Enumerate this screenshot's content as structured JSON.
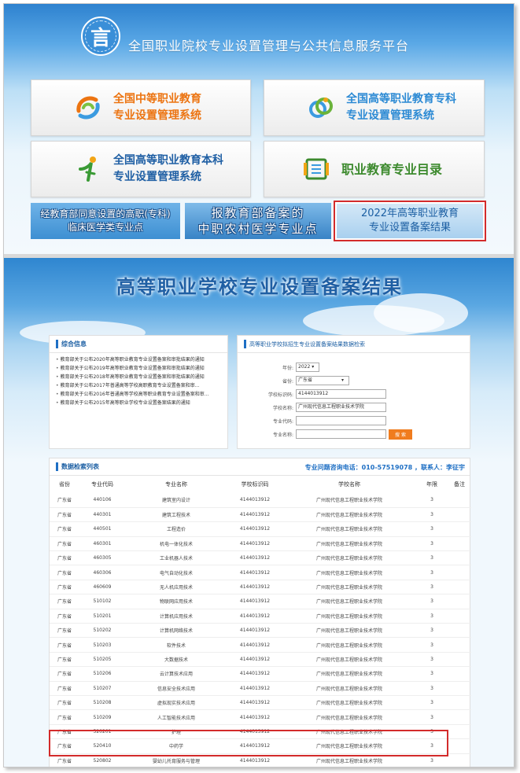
{
  "portal": {
    "title": "全国职业院校专业设置管理与公共信息服务平台",
    "systems": [
      {
        "line1": "全国中等职业教育",
        "line2": "专业设置管理系统"
      },
      {
        "line1": "全国高等职业教育专科",
        "line2": "专业设置管理系统"
      },
      {
        "line1": "全国高等职业教育本科",
        "line2": "专业设置管理系统"
      },
      {
        "line1": "职业教育专业目录"
      }
    ],
    "banners": [
      {
        "line1": "经教育部同意设置的高职(专科)",
        "line2": "临床医学类专业点"
      },
      {
        "line1": "报教育部备案的",
        "line2": "中职农村医学专业点"
      },
      {
        "line1": "2022年高等职业教育",
        "line2": "专业设置备案结果"
      }
    ]
  },
  "page_title": "高等职业学校专业设置备案结果",
  "info": {
    "heading": "综合信息",
    "news": [
      "教育部关于公布2020年高等职业教育专业设置备案和审批结果的通知",
      "教育部关于公布2019年高等职业教育专业设置备案和审批结果的通知",
      "教育部关于公布2018年高等职业教育专业设置备案和审批结果的通知",
      "教育部关于公布2017年普通高等学校高职教育专业设置备案和审...",
      "教育部关于公布2016年普通高等学校高等职业教育专业设置备案和审...",
      "教育部关于公布2015年高等职业学校专业设置备案结果的通知"
    ]
  },
  "search": {
    "heading": "高等职业学校拟招生专业设置备案结果数据检索",
    "year_label": "年份:",
    "year_value": "2022",
    "province_label": "省份:",
    "province_value": "广东省",
    "school_id_label": "学校标识码:",
    "school_id_value": "4144013912",
    "school_name_label": "学校名称:",
    "school_name_value": "广州现代信息工程职业技术学院",
    "major_code_label": "专业代码:",
    "major_code_value": "",
    "major_name_label": "专业名称:",
    "major_name_value": "",
    "button": "搜 索"
  },
  "results": {
    "heading": "数据检索列表",
    "contact": "专业问题咨询电话：010-57519078 ，联系人：李征宇",
    "columns": [
      "省份",
      "专业代码",
      "专业名称",
      "学校标识码",
      "学校名称",
      "年限",
      "备注"
    ],
    "rows": [
      [
        "广东省",
        "440106",
        "建筑室内设计",
        "4144013912",
        "广州现代信息工程职业技术学院",
        "3",
        ""
      ],
      [
        "广东省",
        "440301",
        "建筑工程技术",
        "4144013912",
        "广州现代信息工程职业技术学院",
        "3",
        ""
      ],
      [
        "广东省",
        "440501",
        "工程造价",
        "4144013912",
        "广州现代信息工程职业技术学院",
        "3",
        ""
      ],
      [
        "广东省",
        "460301",
        "机电一体化技术",
        "4144013912",
        "广州现代信息工程职业技术学院",
        "3",
        ""
      ],
      [
        "广东省",
        "460305",
        "工业机器人技术",
        "4144013912",
        "广州现代信息工程职业技术学院",
        "3",
        ""
      ],
      [
        "广东省",
        "460306",
        "电气自动化技术",
        "4144013912",
        "广州现代信息工程职业技术学院",
        "3",
        ""
      ],
      [
        "广东省",
        "460609",
        "无人机应用技术",
        "4144013912",
        "广州现代信息工程职业技术学院",
        "3",
        ""
      ],
      [
        "广东省",
        "510102",
        "物联网应用技术",
        "4144013912",
        "广州现代信息工程职业技术学院",
        "3",
        ""
      ],
      [
        "广东省",
        "510201",
        "计算机应用技术",
        "4144013912",
        "广州现代信息工程职业技术学院",
        "3",
        ""
      ],
      [
        "广东省",
        "510202",
        "计算机网络技术",
        "4144013912",
        "广州现代信息工程职业技术学院",
        "3",
        ""
      ],
      [
        "广东省",
        "510203",
        "软件技术",
        "4144013912",
        "广州现代信息工程职业技术学院",
        "3",
        ""
      ],
      [
        "广东省",
        "510205",
        "大数据技术",
        "4144013912",
        "广州现代信息工程职业技术学院",
        "3",
        ""
      ],
      [
        "广东省",
        "510206",
        "云计算技术应用",
        "4144013912",
        "广州现代信息工程职业技术学院",
        "3",
        ""
      ],
      [
        "广东省",
        "510207",
        "信息安全技术应用",
        "4144013912",
        "广州现代信息工程职业技术学院",
        "3",
        ""
      ],
      [
        "广东省",
        "510208",
        "虚拟现实技术应用",
        "4144013912",
        "广州现代信息工程职业技术学院",
        "3",
        ""
      ],
      [
        "广东省",
        "510209",
        "人工智能技术应用",
        "4144013912",
        "广州现代信息工程职业技术学院",
        "3",
        ""
      ],
      [
        "广东省",
        "520201",
        "护理",
        "4144013912",
        "广州现代信息工程职业技术学院",
        "3",
        ""
      ],
      [
        "广东省",
        "520410",
        "中药学",
        "4144013912",
        "广州现代信息工程职业技术学院",
        "3",
        ""
      ],
      [
        "广东省",
        "520802",
        "婴幼儿托育服务与管理",
        "4144013912",
        "广州现代信息工程职业技术学院",
        "3",
        ""
      ]
    ]
  }
}
